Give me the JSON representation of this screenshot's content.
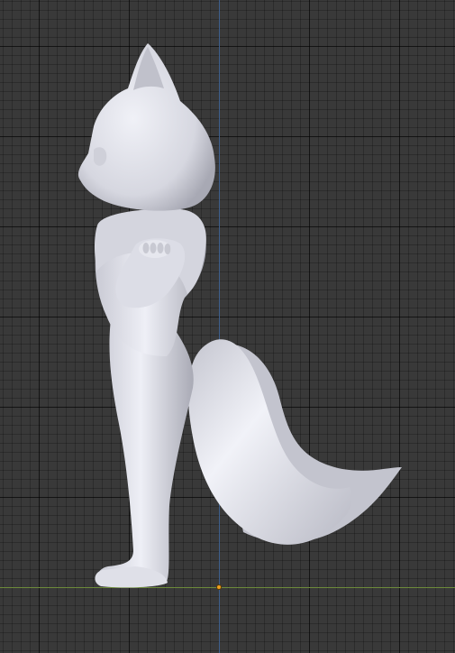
{
  "viewport": {
    "background_color": "#393939",
    "grid_major_color": "#2a2a2a",
    "grid_minor_color": "#333333",
    "axis_z_color": "#3e5f8c",
    "axis_x_color": "#6c8a3a",
    "origin_color": "#f0a020"
  },
  "model": {
    "icon": "fox-character-mesh",
    "material_color": "#d9dae3",
    "shade_color": "#9fa0ab"
  }
}
